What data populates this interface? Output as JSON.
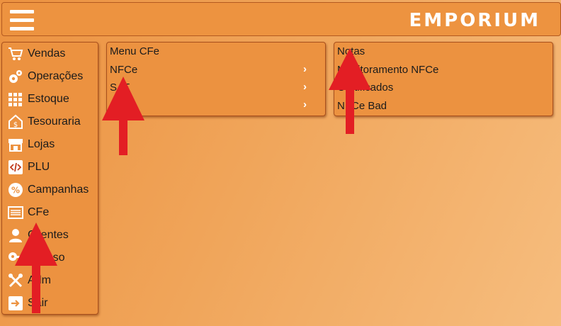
{
  "header": {
    "brand": "EMPORIUM",
    "menu_icon": "hamburger-icon"
  },
  "sidebar": {
    "items": [
      {
        "label": "Vendas",
        "icon": "cart-icon"
      },
      {
        "label": "Operações",
        "icon": "gears-icon"
      },
      {
        "label": "Estoque",
        "icon": "boxes-icon"
      },
      {
        "label": "Tesouraria",
        "icon": "money-house-icon"
      },
      {
        "label": "Lojas",
        "icon": "store-icon"
      },
      {
        "label": "PLU",
        "icon": "code-icon"
      },
      {
        "label": "Campanhas",
        "icon": "percent-badge-icon"
      },
      {
        "label": "CFe",
        "icon": "receipt-icon"
      },
      {
        "label": "Clientes",
        "icon": "user-icon"
      },
      {
        "label": "Acesso",
        "icon": "key-icon"
      },
      {
        "label": "Adm",
        "icon": "tools-icon"
      },
      {
        "label": "Sair",
        "icon": "exit-icon"
      }
    ]
  },
  "submenu": {
    "items": [
      {
        "label": "Menu CFe",
        "chevron": ""
      },
      {
        "label": "NFCe",
        "chevron": "›"
      },
      {
        "label": "SAT",
        "chevron": "›"
      },
      {
        "label": "",
        "chevron": "›"
      }
    ]
  },
  "submenu2": {
    "items": [
      {
        "label": "Notas"
      },
      {
        "label": "Monitoramento NFCe"
      },
      {
        "label": "Certificados"
      },
      {
        "label": "NFCe Bad"
      }
    ]
  },
  "colors": {
    "panel": "#ec9240",
    "border": "#a9501d",
    "arrow": "#e31e24",
    "text": "#1b1b1b"
  }
}
